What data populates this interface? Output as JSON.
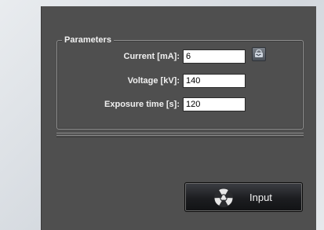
{
  "parameters": {
    "title": "Parameters",
    "current": {
      "label": "Current [mA]:",
      "value": "6"
    },
    "voltage": {
      "label": "Voltage [kV]:",
      "value": "140"
    },
    "exposure": {
      "label": "Exposure time [s]:",
      "value": "120"
    }
  },
  "input_button": {
    "label": "Input",
    "icon": "radiation-icon"
  },
  "lock_button": {
    "icon": "lock-link-icon"
  }
}
